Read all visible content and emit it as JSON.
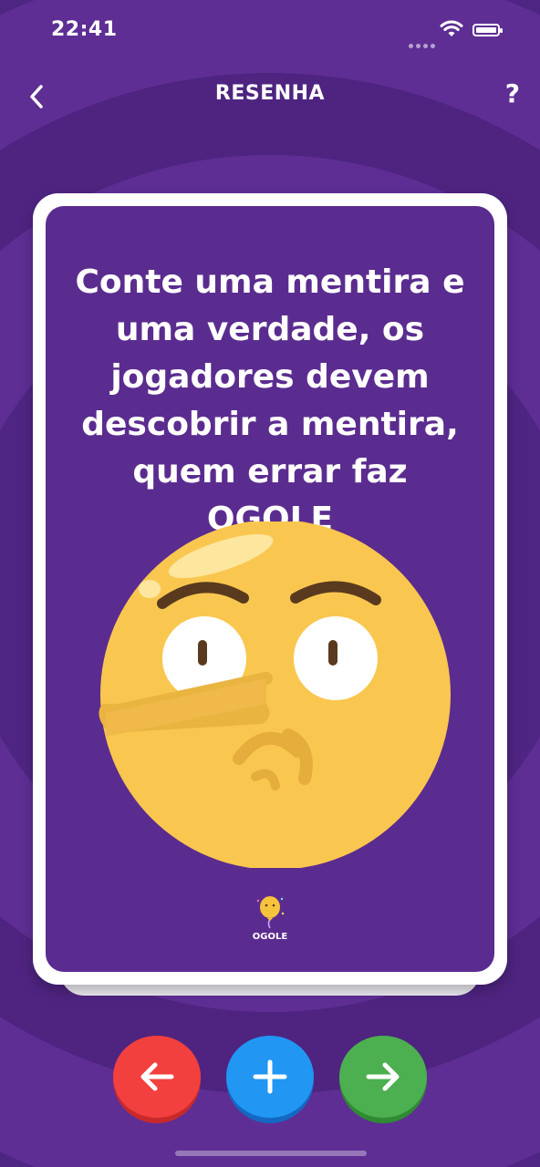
{
  "status_bar": {
    "time": "22:41"
  },
  "nav": {
    "title": "RESENHA",
    "help_label": "?"
  },
  "card": {
    "prompt": "Conte uma mentira e uma verdade, os jogadores devem descobrir a mentira, quem errar faz OGOLE",
    "brand_name": "OGOLE",
    "emoji_icon": "lying-face-emoji"
  },
  "controls": {
    "previous_icon": "arrow-left-icon",
    "add_icon": "plus-icon",
    "next_icon": "arrow-right-icon"
  },
  "colors": {
    "background": "#5b2c8f",
    "card_border": "#ffffff",
    "previous_button": "#f2403f",
    "add_button": "#2196f3",
    "next_button": "#4caf50",
    "emoji_face": "#f9c74f"
  }
}
